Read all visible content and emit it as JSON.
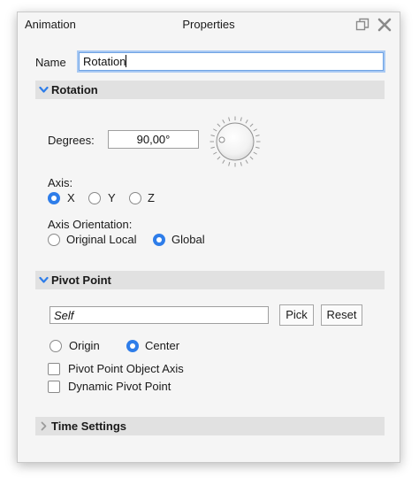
{
  "window": {
    "tab_title": "Animation",
    "title": "Properties"
  },
  "name_field": {
    "label": "Name",
    "value": "Rotation"
  },
  "rotation_section": {
    "title": "Rotation",
    "expanded": true,
    "degrees_label": "Degrees:",
    "degrees_value": "90,00°",
    "axis_label": "Axis:",
    "axis_options": [
      "X",
      "Y",
      "Z"
    ],
    "axis_selected": "X",
    "orientation_label": "Axis Orientation:",
    "orientation_options": [
      "Original Local",
      "Global"
    ],
    "orientation_selected": "Global"
  },
  "pivot_section": {
    "title": "Pivot Point",
    "expanded": true,
    "pivot_value": "Self",
    "pick_label": "Pick",
    "reset_label": "Reset",
    "mode_options": [
      "Origin",
      "Center"
    ],
    "mode_selected": "Center",
    "object_axis_label": "Pivot Point Object Axis",
    "object_axis_checked": false,
    "dynamic_label": "Dynamic Pivot Point",
    "dynamic_checked": false
  },
  "time_section": {
    "title": "Time Settings",
    "expanded": false
  },
  "colors": {
    "accent": "#2e7de9",
    "focus_ring": "#a8c9f3",
    "section_bg": "#e1e1e1"
  }
}
